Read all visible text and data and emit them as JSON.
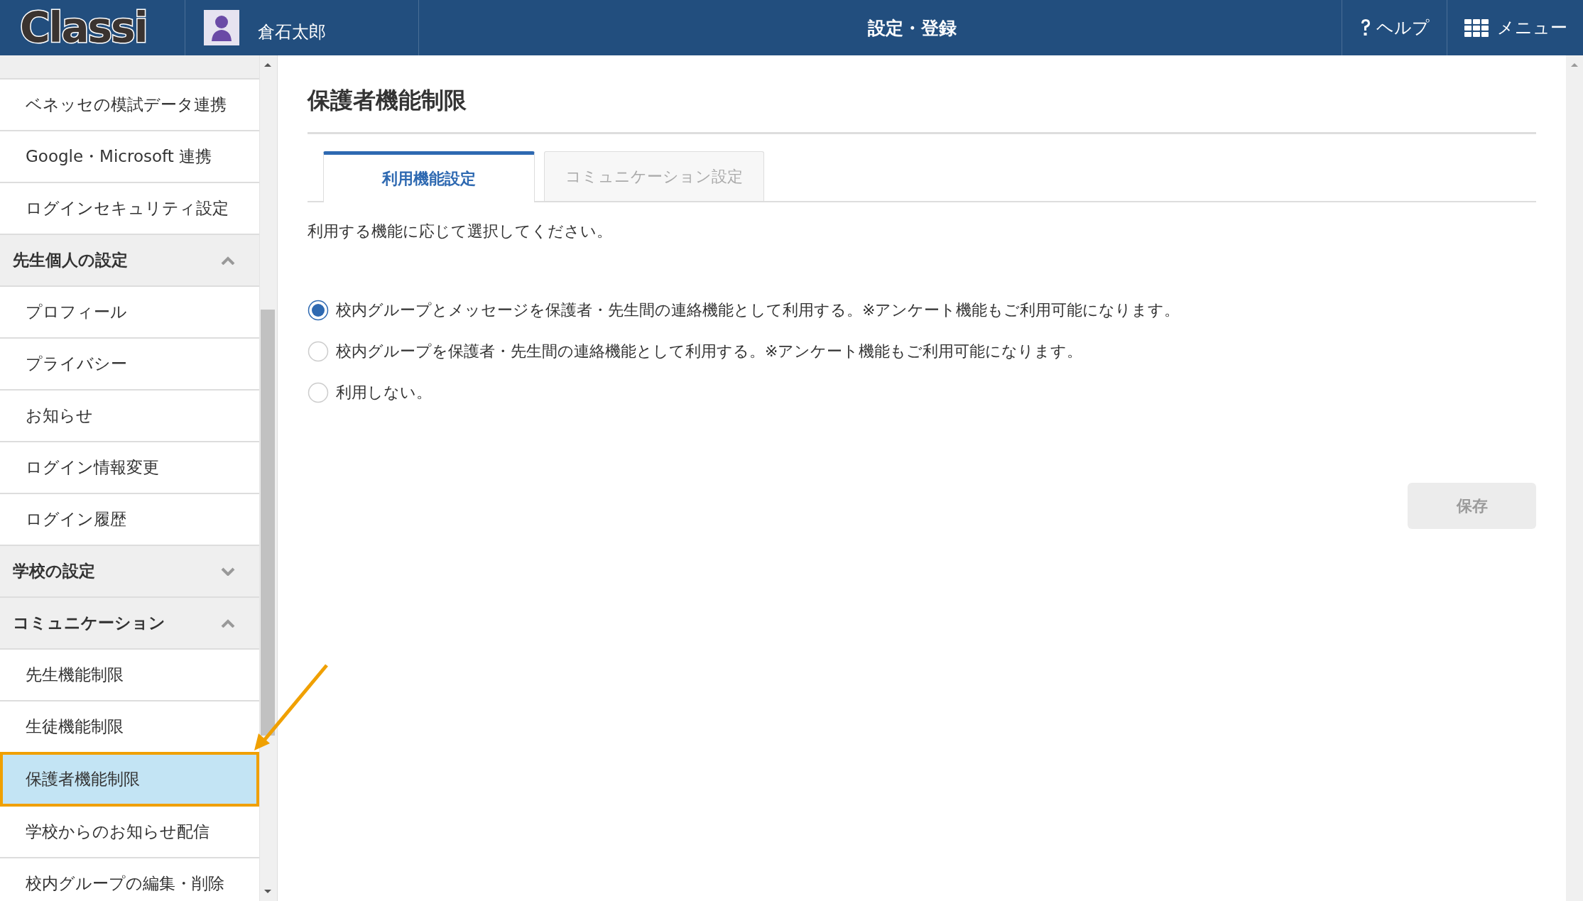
{
  "header": {
    "logo": "Classi",
    "user_name": "倉石太郎",
    "title": "設定・登録",
    "help": "ヘルプ",
    "menu": "メニュー"
  },
  "sidebar": {
    "items": [
      {
        "kind": "item",
        "label": "ベネッセの模試データ連携",
        "selected": false
      },
      {
        "kind": "item",
        "label": "Google・Microsoft 連携",
        "selected": false
      },
      {
        "kind": "item",
        "label": "ログインセキュリティ設定",
        "selected": false
      },
      {
        "kind": "header",
        "label": "先生個人の設定",
        "expanded": true
      },
      {
        "kind": "item",
        "label": "プロフィール",
        "selected": false
      },
      {
        "kind": "item",
        "label": "プライバシー",
        "selected": false
      },
      {
        "kind": "item",
        "label": "お知らせ",
        "selected": false
      },
      {
        "kind": "item",
        "label": "ログイン情報変更",
        "selected": false
      },
      {
        "kind": "item",
        "label": "ログイン履歴",
        "selected": false
      },
      {
        "kind": "header",
        "label": "学校の設定",
        "expanded": false
      },
      {
        "kind": "header",
        "label": "コミュニケーション",
        "expanded": true
      },
      {
        "kind": "item",
        "label": "先生機能制限",
        "selected": false
      },
      {
        "kind": "item",
        "label": "生徒機能制限",
        "selected": false
      },
      {
        "kind": "item",
        "label": "保護者機能制限",
        "selected": true
      },
      {
        "kind": "item",
        "label": "学校からのお知らせ配信",
        "selected": false
      },
      {
        "kind": "item",
        "label": "校内グループの編集・削除",
        "selected": false
      }
    ]
  },
  "main": {
    "title": "保護者機能制限",
    "tabs": [
      {
        "label": "利用機能設定",
        "selected": true
      },
      {
        "label": "コミュニケーション設定",
        "selected": false
      }
    ],
    "instruction": "利用する機能に応じて選択してください。",
    "options": [
      {
        "label": "校内グループとメッセージを保護者・先生間の連絡機能として利用する。※アンケート機能もご利用可能になります。",
        "selected": true
      },
      {
        "label": "校内グループを保護者・先生間の連絡機能として利用する。※アンケート機能もご利用可能になります。",
        "selected": false
      },
      {
        "label": "利用しない。",
        "selected": false
      }
    ],
    "save_button": {
      "label": "保存",
      "disabled": true
    }
  }
}
